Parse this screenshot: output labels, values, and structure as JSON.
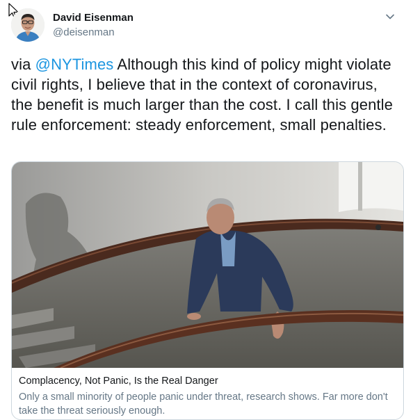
{
  "author": {
    "name": "David Eisenman",
    "handle": "@deisenman",
    "avatar_icon": "user-avatar"
  },
  "tweet": {
    "prefix": "via ",
    "mention": "@NYTimes",
    "body": " Although this kind of policy might violate civil rights, I believe that in the context of coronavirus, the benefit is much larger than the cost. I call this gentle rule enforcement: steady enforcement, small penalties."
  },
  "link_card": {
    "title": "Complacency, Not Panic, Is the Real Danger",
    "description": "Only a small minority of people panic under threat, research shows. Far more don't take the threat seriously enough."
  },
  "icons": {
    "menu": "chevron-down-icon",
    "pointer": "mouse-cursor-icon"
  },
  "colors": {
    "link": "#1b95e0",
    "secondary_text": "#657786",
    "border": "#ccd6dd"
  }
}
